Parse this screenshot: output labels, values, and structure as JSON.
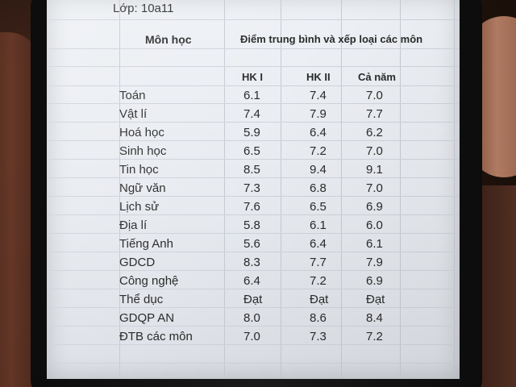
{
  "sheet": {
    "class_label": "Lớp: 10a11",
    "header_subject": "Môn học",
    "header_average": "Điểm trung bình và xếp loại các môn",
    "term_headers": [
      "HK I",
      "HK II",
      "Cả năm"
    ]
  },
  "rows": [
    {
      "subject": "Toán",
      "hk1": "6.1",
      "hk2": "7.4",
      "year": "7.0"
    },
    {
      "subject": "Vật lí",
      "hk1": "7.4",
      "hk2": "7.9",
      "year": "7.7"
    },
    {
      "subject": "Hoá học",
      "hk1": "5.9",
      "hk2": "6.4",
      "year": "6.2"
    },
    {
      "subject": "Sinh học",
      "hk1": "6.5",
      "hk2": "7.2",
      "year": "7.0"
    },
    {
      "subject": "Tin học",
      "hk1": "8.5",
      "hk2": "9.4",
      "year": "9.1"
    },
    {
      "subject": "Ngữ văn",
      "hk1": "7.3",
      "hk2": "6.8",
      "year": "7.0"
    },
    {
      "subject": "Lịch sử",
      "hk1": "7.6",
      "hk2": "6.5",
      "year": "6.9"
    },
    {
      "subject": "Địa lí",
      "hk1": "5.8",
      "hk2": "6.1",
      "year": "6.0"
    },
    {
      "subject": "Tiếng Anh",
      "hk1": "5.6",
      "hk2": "6.4",
      "year": "6.1"
    },
    {
      "subject": "GDCD",
      "hk1": "8.3",
      "hk2": "7.7",
      "year": "7.9"
    },
    {
      "subject": "Công nghệ",
      "hk1": "6.4",
      "hk2": "7.2",
      "year": "6.9"
    },
    {
      "subject": "Thể dục",
      "hk1": "Đạt",
      "hk2": "Đạt",
      "year": "Đạt"
    },
    {
      "subject": "GDQP AN",
      "hk1": "8.0",
      "hk2": "8.6",
      "year": "8.4"
    },
    {
      "subject": "ĐTB các môn",
      "hk1": "7.0",
      "hk2": "7.3",
      "year": "7.2"
    }
  ]
}
